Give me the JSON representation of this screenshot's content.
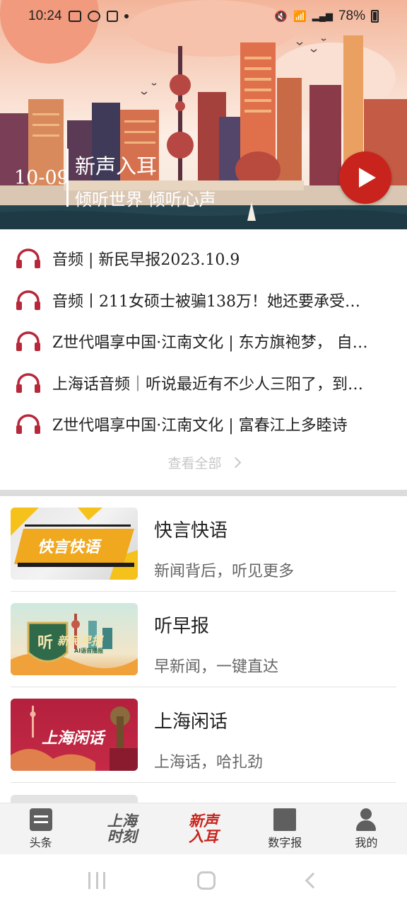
{
  "status_bar": {
    "time": "10:24",
    "battery": "78%",
    "left_icons": [
      "gallery-icon",
      "cloud-icon",
      "car-icon",
      "dot-icon"
    ],
    "right_icons": [
      "mute-icon",
      "wifi-icon",
      "signal-icon",
      "battery-icon"
    ]
  },
  "banner": {
    "date": "10-09",
    "title": "新声入耳",
    "subtitle": "倾听世界 倾听心声",
    "accent": "#c8241d"
  },
  "audio_list": {
    "items": [
      {
        "text": "音频 | 新民早报2023.10.9"
      },
      {
        "text": "音频丨211女硕士被骗138万！她还要承受…"
      },
      {
        "text": "Z世代唱享中国·江南文化 | 东方旗袍梦， 自…"
      },
      {
        "text": "上海话音频｜听说最近有不少人三阳了，到…"
      },
      {
        "text": "Z世代唱享中国·江南文化 | 富春江上多睦诗"
      }
    ],
    "view_all": "查看全部"
  },
  "channels": [
    {
      "title": "快言快语",
      "subtitle": "新闻背后，听见更多",
      "thumb_label": "快言快语"
    },
    {
      "title": "听早报",
      "subtitle": "早新闻，一键直达",
      "thumb_label": "新民早报",
      "thumb_badge": "听",
      "thumb_small": "AI语音播报"
    },
    {
      "title": "上海闲话",
      "subtitle": "上海话，哈扎劲",
      "thumb_label": "上海闲话"
    }
  ],
  "bottom_nav": {
    "items": [
      {
        "label": "头条",
        "icon": "news-list-icon"
      },
      {
        "label": "上海\n时刻",
        "icon": "shanghai-moment-logo"
      },
      {
        "label": "新声\n入耳",
        "icon": "new-voice-logo"
      },
      {
        "label": "数字报",
        "icon": "digital-paper-icon"
      },
      {
        "label": "我的",
        "icon": "user-icon"
      }
    ]
  }
}
